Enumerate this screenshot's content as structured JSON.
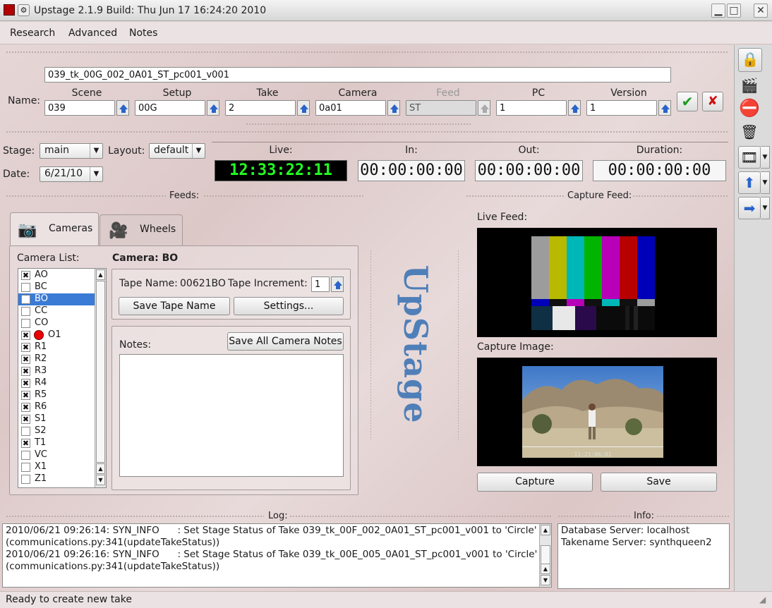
{
  "window": {
    "title": "Upstage 2.1.9  Build: Thu Jun 17 16:24:20 2010",
    "min_glyph": "▁",
    "max_glyph": "□",
    "close_glyph": "✕"
  },
  "menu": [
    "Research",
    "Advanced",
    "Notes"
  ],
  "name_row": {
    "label": "Name:",
    "full_name": "039_tk_00G_002_0A01_ST_pc001_v001",
    "fields": [
      {
        "label": "Scene",
        "value": "039"
      },
      {
        "label": "Setup",
        "value": "00G"
      },
      {
        "label": "Take",
        "value": "2"
      },
      {
        "label": "Camera",
        "value": "0a01"
      },
      {
        "label": "Feed",
        "value": "ST"
      },
      {
        "label": "PC",
        "value": "1"
      },
      {
        "label": "Version",
        "value": "1"
      }
    ],
    "accept_glyph": "✔",
    "reject_glyph": "✘"
  },
  "stage": {
    "label": "Stage:",
    "value": "main"
  },
  "layout": {
    "label": "Layout:",
    "value": "default"
  },
  "date": {
    "label": "Date:",
    "value": "6/21/10"
  },
  "timecodes": {
    "live_label": "Live:",
    "live": "12:33:22:11",
    "in_label": "In:",
    "in": "00:00:00:00",
    "out_label": "Out:",
    "out": "00:00:00:00",
    "duration_label": "Duration:",
    "duration": "00:00:00:00"
  },
  "sections": {
    "feeds": "Feeds:",
    "capture_feed": "Capture Feed:",
    "log": "Log:",
    "info": "Info:"
  },
  "tabs": [
    {
      "label": "Cameras",
      "active": true
    },
    {
      "label": "Wheels",
      "active": false
    }
  ],
  "camera_list": {
    "label": "Camera List:",
    "items": [
      {
        "name": "AO",
        "checked": true
      },
      {
        "name": "BC",
        "checked": false
      },
      {
        "name": "BO",
        "checked": false,
        "selected": true
      },
      {
        "name": "CC",
        "checked": false
      },
      {
        "name": "CO",
        "checked": false
      },
      {
        "name": "O1",
        "checked": true,
        "recording": true
      },
      {
        "name": "R1",
        "checked": true
      },
      {
        "name": "R2",
        "checked": true
      },
      {
        "name": "R3",
        "checked": true
      },
      {
        "name": "R4",
        "checked": true
      },
      {
        "name": "R5",
        "checked": true
      },
      {
        "name": "R6",
        "checked": true
      },
      {
        "name": "S1",
        "checked": true
      },
      {
        "name": "S2",
        "checked": false
      },
      {
        "name": "T1",
        "checked": true
      },
      {
        "name": "VC",
        "checked": false
      },
      {
        "name": "X1",
        "checked": false
      },
      {
        "name": "Z1",
        "checked": false
      }
    ]
  },
  "camera_detail": {
    "title": "Camera: BO",
    "tape_name_label": "Tape Name:",
    "tape_name": "00621BO",
    "tape_increment_label": "Tape Increment:",
    "tape_increment": "1",
    "save_tape_button": "Save Tape Name",
    "settings_button": "Settings...",
    "notes_label": "Notes:",
    "save_notes_button": "Save All Camera Notes",
    "notes": ""
  },
  "logo_text": "UpStage",
  "capture": {
    "live_feed_label": "Live Feed:",
    "capture_image_label": "Capture Image:",
    "image_timecode": "11:21:06:01",
    "capture_button": "Capture",
    "save_button": "Save"
  },
  "colors": {
    "bars_top": [
      "#9c9c9c",
      "#b9b900",
      "#00b7b7",
      "#00b400",
      "#b800b8",
      "#b80000",
      "#0000b8"
    ],
    "live_bg": "#000000",
    "live_fg": "#22ff22"
  },
  "log_lines": [
    "2010/06/21 09:26:14: SYN_INFO      : Set Stage Status of Take 039_tk_00F_002_0A01_ST_pc001_v001 to 'Circle'",
    "(communications.py:341(updateTakeStatus))",
    "2010/06/21 09:26:16: SYN_INFO      : Set Stage Status of Take 039_tk_00E_005_0A01_ST_pc001_v001 to 'Circle'",
    "(communications.py:341(updateTakeStatus))"
  ],
  "info_lines": [
    "Database Server: localhost",
    "Takename Server: synthqueen2"
  ],
  "status": "Ready to create new take",
  "toolbar_icons": [
    "lock-icon",
    "clapper-icon",
    "stop-icon",
    "trash-icon",
    "film-icon",
    "up-arrow-icon",
    "right-arrow-icon"
  ]
}
